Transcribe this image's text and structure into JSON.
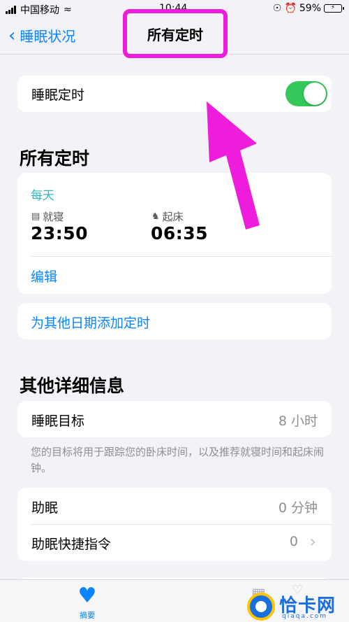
{
  "status_bar": {
    "carrier": "中国移动",
    "time": "10:44",
    "battery": "59%"
  },
  "nav": {
    "back_label": "睡眠状况",
    "title": "所有定时"
  },
  "sleep_schedule": {
    "label": "睡眠定时",
    "enabled": true
  },
  "all_schedules": {
    "section_title": "所有定时",
    "days": "每天",
    "bedtime_label": "就寝",
    "bedtime": "23:50",
    "wakeup_label": "起床",
    "wakeup": "06:35",
    "edit_label": "编辑",
    "add_label": "为其他日期添加定时"
  },
  "details": {
    "section_title": "其他详细信息",
    "sleep_goal_label": "睡眠目标",
    "sleep_goal_value": "8 小时",
    "footnote": "您的目标将用于跟踪您的卧床时间，以及推荐就寝时间和起床闹钟。",
    "wind_down_label": "助眠",
    "wind_down_value": "0 分钟",
    "shortcuts_label": "助眠快捷指令",
    "shortcuts_value": "0"
  },
  "tab_bar": {
    "summary_label": "摘要"
  },
  "watermark": {
    "name": "恰卡网",
    "domain": "qiaqa.com"
  },
  "colors": {
    "accent_blue": "#0a84ff",
    "toggle_green": "#34c759",
    "teal": "#2fb5c6",
    "annotation_magenta": "#ee1ddb"
  }
}
